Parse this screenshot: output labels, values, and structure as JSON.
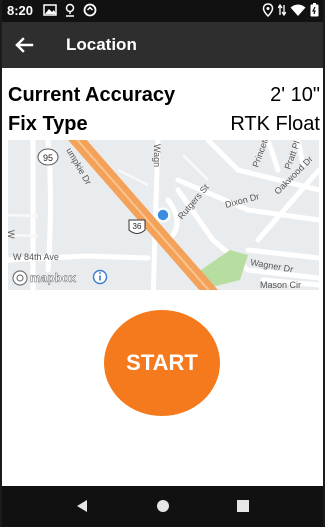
{
  "status_bar": {
    "time": "8:20",
    "left_icons": [
      "image-icon",
      "location-badge-icon",
      "sync-icon"
    ],
    "right_icons": [
      "location-pin-icon",
      "data-arrows-icon",
      "wifi-icon",
      "battery-icon"
    ]
  },
  "app_bar": {
    "title": "Location",
    "back_icon": "arrow-left-icon"
  },
  "accuracy": {
    "label": "Current Accuracy",
    "value": "2' 10\""
  },
  "fix": {
    "label": "Fix Type",
    "value": "RTK Float"
  },
  "map": {
    "street_labels": {
      "trumpkie": "umpkie Dr",
      "wagn": "Wagn",
      "rutgers": "Rutgers St",
      "dixon": "Dixon Dr",
      "oakwood": "Oakwood Dr",
      "princeton": "Princeto",
      "pratt": "Pratt Pl",
      "wagner": "Wagner Dr",
      "mason": "Mason Cir",
      "w84": "W 84th Ave",
      "route95": "95",
      "route36": "36",
      "clipped_w": "W"
    },
    "attribution": "mapbox",
    "info_icon": "info-icon",
    "colors": {
      "highway": "#f4a25a",
      "park": "#b8dda0",
      "location_dot": "#3b8de0",
      "background": "#e9ecef"
    }
  },
  "start_button": {
    "label": "START",
    "color": "#f57a1e"
  },
  "nav_bar": {
    "icons": [
      "back-triangle-icon",
      "home-circle-icon",
      "recents-square-icon"
    ]
  }
}
